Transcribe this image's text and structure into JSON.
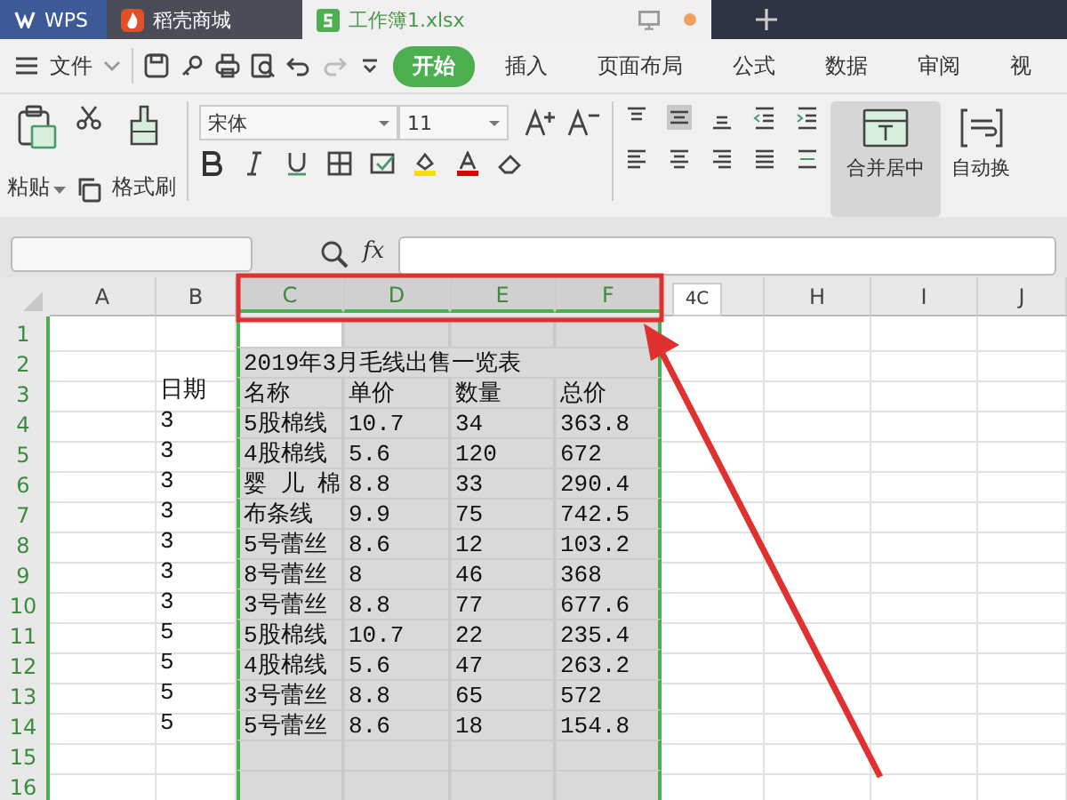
{
  "tabs": [
    {
      "label": "WPS",
      "kind": "app",
      "selected": false
    },
    {
      "label": "稻壳商城",
      "kind": "store",
      "selected": false
    },
    {
      "label": "工作簿1.xlsx",
      "kind": "doc",
      "selected": true
    }
  ],
  "menu": {
    "file": "文件",
    "items": [
      {
        "label": "开始",
        "selected": true
      },
      {
        "label": "插入",
        "selected": false
      },
      {
        "label": "页面布局",
        "selected": false
      },
      {
        "label": "公式",
        "selected": false
      },
      {
        "label": "数据",
        "selected": false
      },
      {
        "label": "审阅",
        "selected": false
      },
      {
        "label": "视",
        "selected": false
      }
    ]
  },
  "ribbon": {
    "paste": "粘贴",
    "format_painter": "格式刷",
    "font": "宋体",
    "font_size": "11",
    "merge": "合并居中",
    "wrap": "自动换"
  },
  "formula_bar": {
    "fx": "fx"
  },
  "sheet": {
    "columns": [
      {
        "label": "A",
        "selected": false,
        "active": false
      },
      {
        "label": "B",
        "selected": false,
        "active": false
      },
      {
        "label": "C",
        "selected": true,
        "active": true
      },
      {
        "label": "D",
        "selected": true,
        "active": false
      },
      {
        "label": "E",
        "selected": true,
        "active": false
      },
      {
        "label": "F",
        "selected": true,
        "active": false
      },
      {
        "selected": false,
        "active": false
      },
      {
        "label": "H",
        "selected": false,
        "active": false
      },
      {
        "label": "I",
        "selected": false,
        "active": false
      },
      {
        "label": "J",
        "selected": false,
        "active": false
      }
    ],
    "tooltip": "4C",
    "rows": [
      {
        "number": "1",
        "active": true
      },
      {
        "number": "2",
        "active": false,
        "title": "2019年3月毛线出售一览表"
      },
      {
        "number": "3",
        "active": false,
        "cells": [
          "日期",
          "名称",
          "单价",
          "数量",
          "总价"
        ]
      },
      {
        "number": "4",
        "active": false,
        "cells": [
          "3",
          "5股棉线",
          "10.7",
          "34",
          "363.8"
        ]
      },
      {
        "number": "5",
        "active": false,
        "cells": [
          "3",
          "4股棉线",
          "5.6",
          "120",
          "672"
        ]
      },
      {
        "number": "6",
        "active": false,
        "cells": [
          "3",
          "婴 儿 棉",
          "8.8",
          "33",
          "290.4"
        ]
      },
      {
        "number": "7",
        "active": false,
        "cells": [
          "3",
          "布条线",
          "9.9",
          "75",
          "742.5"
        ]
      },
      {
        "number": "8",
        "active": false,
        "cells": [
          "3",
          "5号蕾丝",
          "8.6",
          "12",
          "103.2"
        ]
      },
      {
        "number": "9",
        "active": false,
        "cells": [
          "3",
          "8号蕾丝",
          "8",
          "46",
          "368"
        ]
      },
      {
        "number": "10",
        "active": false,
        "cells": [
          "3",
          "3号蕾丝",
          "8.8",
          "77",
          "677.6"
        ]
      },
      {
        "number": "11",
        "active": false,
        "cells": [
          "5",
          "5股棉线",
          "10.7",
          "22",
          "235.4"
        ]
      },
      {
        "number": "12",
        "active": false,
        "cells": [
          "5",
          "4股棉线",
          "5.6",
          "47",
          "263.2"
        ]
      },
      {
        "number": "13",
        "active": false,
        "cells": [
          "5",
          "3号蕾丝",
          "8.8",
          "65",
          "572"
        ]
      },
      {
        "number": "14",
        "active": false,
        "cells": [
          "5",
          "5号蕾丝",
          "8.6",
          "18",
          "154.8"
        ]
      },
      {
        "number": "15",
        "active": false
      },
      {
        "number": "16",
        "active": false
      }
    ]
  }
}
